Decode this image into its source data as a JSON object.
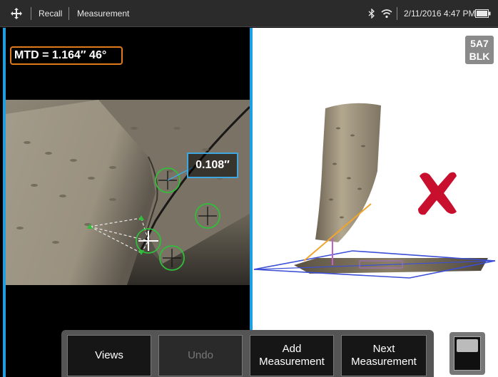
{
  "statusbar": {
    "recall_label": "Recall",
    "measurement_label": "Measurement",
    "datetime": "2/11/2016  4:47 PM"
  },
  "left": {
    "mtd_text": "MTD = 1.164″ 46°",
    "value_text": "0.108″"
  },
  "right": {
    "tag_line1": "5A7",
    "tag_line2": "BLK"
  },
  "buttons": {
    "views": "Views",
    "undo": "Undo",
    "add_measurement_1": "Add",
    "add_measurement_2": "Measurement",
    "next_measurement_1": "Next",
    "next_measurement_2": "Measurement"
  },
  "colors": {
    "accent_blue": "#1f9fe0",
    "mtd_orange": "#e07a1a",
    "cursor_green": "#2fbf3a",
    "error_red": "#c8102e"
  }
}
